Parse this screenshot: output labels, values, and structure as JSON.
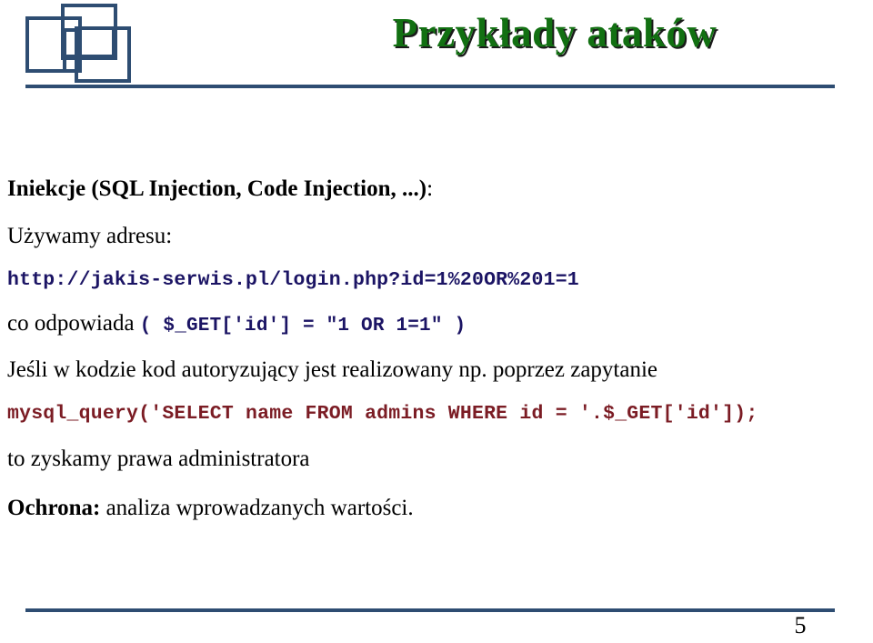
{
  "slide": {
    "title": "Przykłady ataków",
    "title_color": "#127012",
    "accent_color": "#2e4d72",
    "code_navy_color": "#1b1464",
    "code_red_color": "#7b1c24",
    "page_number": "5",
    "logo_name": "three-interlocking-squares-logo"
  },
  "content": {
    "heading": {
      "bold_part": "Iniekcje (SQL Injection, Code Injection, ...)",
      "plain_part": ":"
    },
    "line_uzywamy": "Używamy adresu:",
    "url": "http://jakis-serwis.pl/login.php?id=1%20OR%201=1",
    "line_odpowiada": {
      "prefix": "co odpowiada ",
      "code": "( $_GET['id'] = \"1 OR 1=1\" )"
    },
    "line_jesli": "Jeśli w kodzie kod autoryzujący jest realizowany np. poprzez zapytanie",
    "mysql_query": "mysql_query('SELECT name FROM admins WHERE id = '.$_GET['id']);",
    "line_zyskamy": "to zyskamy prawa administratora",
    "line_ochrona": {
      "bold_part": "Ochrona:",
      "plain_part": " analiza wprowadzanych wartości."
    }
  }
}
